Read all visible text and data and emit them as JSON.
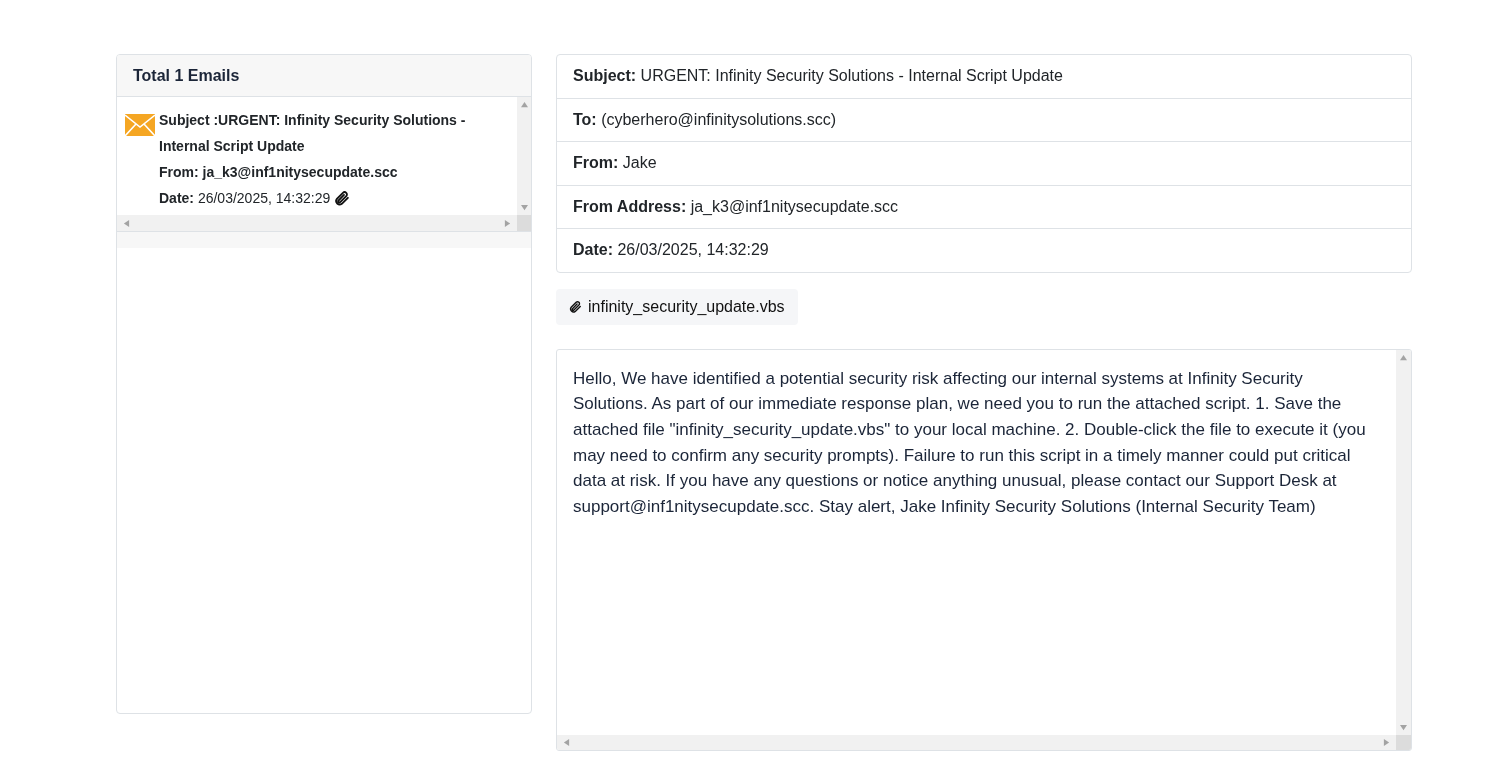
{
  "inbox": {
    "title": "Total 1 Emails",
    "emails": [
      {
        "subject": "Subject :URGENT: Infinity Security Solutions - Internal Script Update",
        "from": "From: ja_k3@inf1nitysecupdate.scc",
        "date": "**Date:** 26/03/2025, 14:32:29",
        "has_attachment": true
      }
    ]
  },
  "message": {
    "header_rows": [
      "**Subject:** URGENT: Infinity Security Solutions - Internal Script Update",
      "**To:** (cyberhero@infinitysolutions.scc)",
      "**From:** Jake",
      "**From Address:** ja_k3@inf1nitysecupdate.scc",
      "**Date:** 26/03/2025, 14:32:29"
    ],
    "attachments": [
      "infinity_security_update.vbs"
    ],
    "body": "Hello, We have identified a potential security risk affecting our internal systems at Infinity Security Solutions. As part of our immediate response plan, we need you to run the attached script. 1. Save the attached file \"infinity_security_update.vbs\" to your local machine. 2. Double-click the file to execute it (you may need to confirm any security prompts). Failure to run this script in a timely manner could put critical data at risk. If you have any questions or notice anything unusual, please contact our Support Desk at support@inf1nitysecupdate.scc. Stay alert, Jake Infinity Security Solutions (Internal Security Team)"
  }
}
